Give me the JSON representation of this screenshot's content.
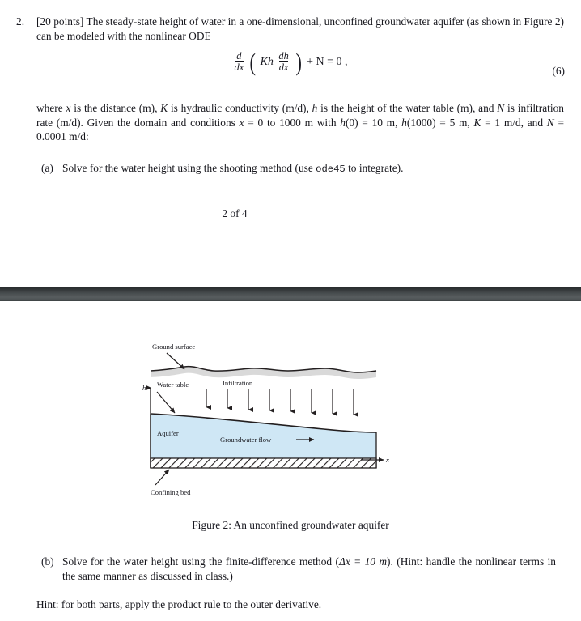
{
  "document": {
    "page_footer": "2 of 4"
  },
  "problem2": {
    "marker": "2.",
    "points_tag": "[20 points]",
    "intro_text": " The steady-state height of water in a one-dimensional, unconfined groundwater aquifer (as shown in Figure 2) can be modeled with the nonlinear ODE",
    "equation": {
      "number": "(6)",
      "d_numerator": "d",
      "d_denominator": "dx",
      "coefficient": "Kh",
      "dh_numerator": "dh",
      "dh_denominator": "dx",
      "open_paren": "(",
      "close_paren": ")",
      "tail": "+ N = 0 ,",
      "plain": "d/dx (Kh dh/dx) + N = 0"
    },
    "where_paragraph": {
      "seg1": "where ",
      "var_x": "x",
      "seg2": " is the distance (m), ",
      "var_K": "K",
      "seg3": " is hydraulic conductivity (m/d), ",
      "var_h": "h",
      "seg4": " is the height of the water table (m), and ",
      "var_N": "N",
      "seg5": " is infiltration rate (m/d).  Given the domain and conditions ",
      "cond_x": "x",
      "seg6": " = 0 to 1000 m with ",
      "cond_h0": "h",
      "seg7": "(0) = 10 m, ",
      "cond_h1000": "h",
      "seg8": "(1000) = 5 m, ",
      "cond_K": "K",
      "seg9": " = 1 m/d, and ",
      "cond_N": "N",
      "seg10": " = 0.0001 m/d:"
    },
    "parts": [
      {
        "marker": "(a)",
        "text_before_code": "Solve for the water height using the shooting method (use ",
        "code": "ode45",
        "text_after_code": " to integrate)."
      },
      {
        "marker": "(b)",
        "text_before_math": "Solve for the water height using the finite-difference method (",
        "math": "Δx = 10 m",
        "text_after_math": ").  (Hint: handle the nonlinear terms in the same manner as discussed in class.)"
      }
    ],
    "final_hint": "Hint: for both parts, apply the product rule to the outer derivative."
  },
  "figure": {
    "caption": "Figure 2: An unconfined groundwater aquifer",
    "labels": {
      "ground_surface": "Ground surface",
      "water_table": "Water table",
      "infiltration": "Infiltration",
      "aquifer": "Aquifer",
      "groundwater_flow": "Groundwater flow",
      "confining_bed": "Confining bed",
      "axis_h": "h",
      "axis_x": "x"
    },
    "colors": {
      "water_fill": "#cfe7f5",
      "ground_band": "#d9d9d9",
      "line": "#231f20",
      "divider_dark": "#2b2f31",
      "divider_light": "#585d5f"
    },
    "infiltration_arrow_count": 8
  }
}
